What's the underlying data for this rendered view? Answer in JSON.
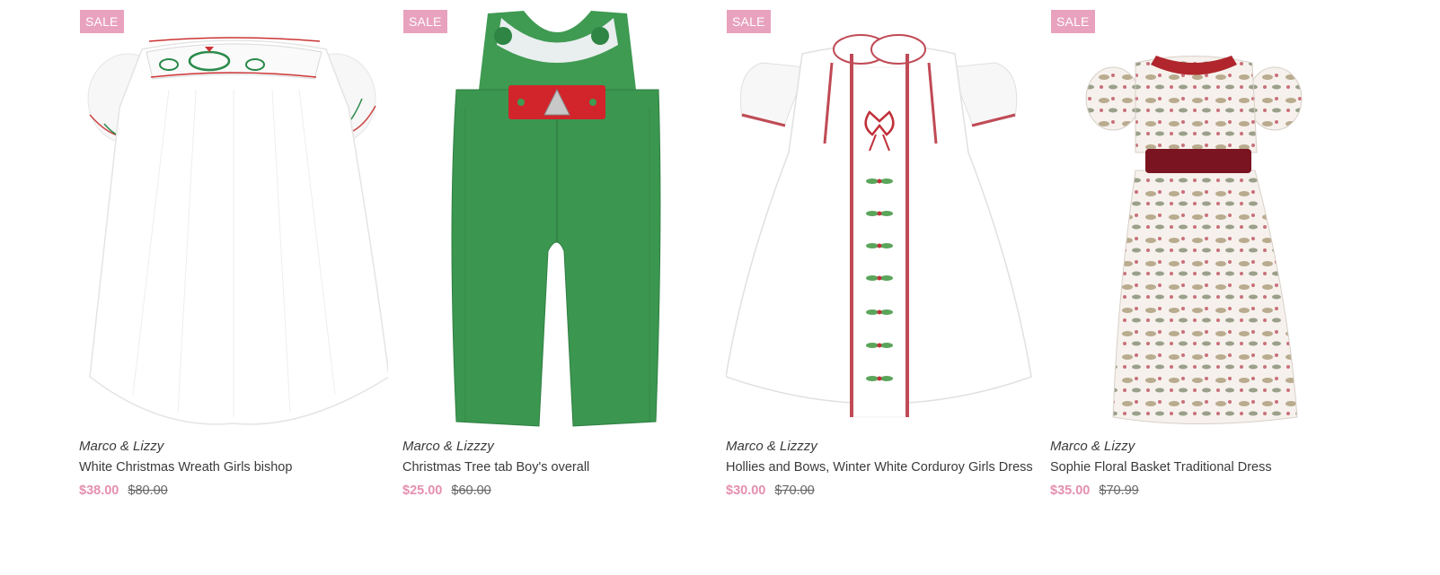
{
  "products": [
    {
      "badge": "SALE",
      "vendor": "Marco & Lizzy",
      "title": "White Christmas Wreath Girls bishop",
      "sale_price": "$38.00",
      "original_price": "$80.00",
      "image_icon": "white-bishop-dress-image"
    },
    {
      "badge": "SALE",
      "vendor": "Marco & Lizzzy",
      "title": "Christmas Tree tab Boy's overall",
      "sale_price": "$25.00",
      "original_price": "$60.00",
      "image_icon": "green-overall-image"
    },
    {
      "badge": "SALE",
      "vendor": "Marco & Lizzzy",
      "title": "Hollies and Bows, Winter White Corduroy Girls Dress",
      "sale_price": "$30.00",
      "original_price": "$70.00",
      "image_icon": "white-corduroy-dress-image"
    },
    {
      "badge": "SALE",
      "vendor": "Marco & Lizzy",
      "title": "Sophie Floral Basket Traditional Dress",
      "sale_price": "$35.00",
      "original_price": "$70.99",
      "image_icon": "floral-dress-image"
    }
  ],
  "colors": {
    "sale_badge": "#e8a2bd",
    "sale_price": "#e58fb0",
    "text": "#3a3a3a",
    "original_price": "#666666"
  }
}
